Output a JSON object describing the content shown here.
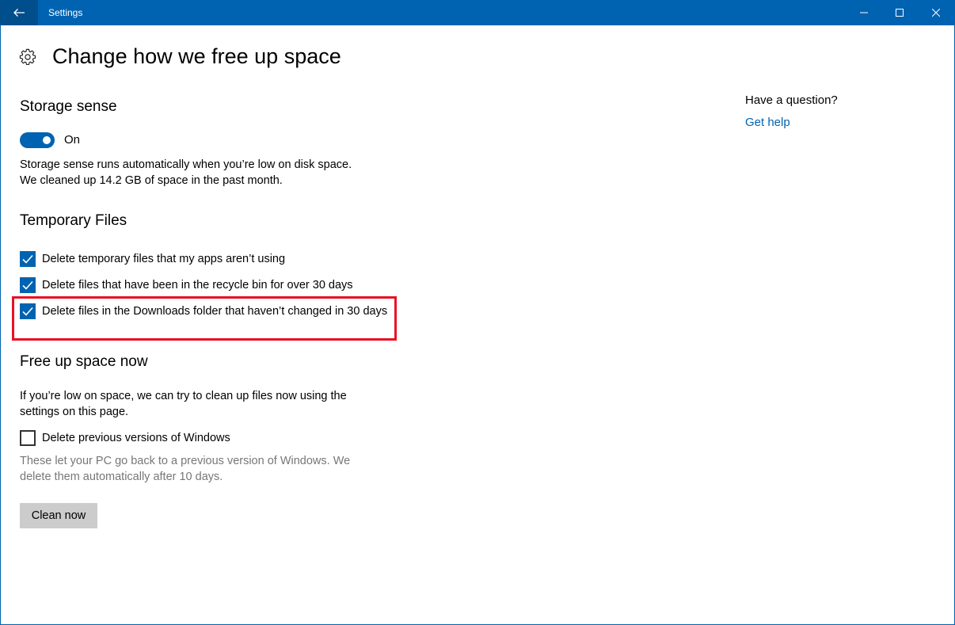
{
  "window": {
    "title": "Settings"
  },
  "page": {
    "title": "Change how we free up space"
  },
  "storage_sense": {
    "heading": "Storage sense",
    "toggle_state": "On",
    "toggle_on": true,
    "desc_line1": "Storage sense runs automatically when you’re low on disk space.",
    "desc_line2": "We cleaned up 14.2 GB of space in the past month."
  },
  "temp_files": {
    "heading": "Temporary Files",
    "options": [
      {
        "label": "Delete temporary files that my apps aren’t using",
        "checked": true
      },
      {
        "label": "Delete files that have been in the recycle bin for over 30 days",
        "checked": true
      },
      {
        "label": "Delete files in the Downloads folder that haven’t changed in 30 days",
        "checked": true
      }
    ]
  },
  "free_up": {
    "heading": "Free up space now",
    "desc": "If you’re low on space, we can try to clean up files now using the settings on this page.",
    "option": {
      "label": "Delete previous versions of Windows",
      "checked": false
    },
    "note": "These let your PC go back to a previous version of Windows. We delete them automatically after 10 days.",
    "button_label": "Clean now"
  },
  "help": {
    "question": "Have a question?",
    "link": "Get help"
  },
  "colors": {
    "accent": "#0063b1",
    "highlight": "#e81123"
  }
}
